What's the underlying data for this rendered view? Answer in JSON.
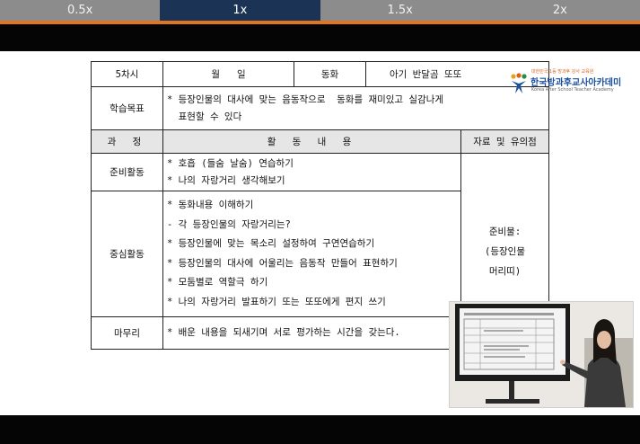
{
  "speed_controls": [
    {
      "label": "0.5x",
      "active": false
    },
    {
      "label": "1x",
      "active": true
    },
    {
      "label": "1.5x",
      "active": false
    },
    {
      "label": "2x",
      "active": false
    }
  ],
  "colors": {
    "speed_bar": "#8c8c8c",
    "speed_active": "#1b3354",
    "accent_line": "#e3741f",
    "logo_blue": "#1a4f9c",
    "logo_orange": "#d9621b"
  },
  "logo": {
    "tagline": "대한민국 1등 방과후 강사 교육원",
    "name": "한국방과후교사아카데미",
    "sub": "Korea After School Teacher Academy"
  },
  "lesson_table": {
    "row1": {
      "session": "5차시",
      "month_day": "월   일",
      "genre_label": "동화",
      "title": "아기 반달곰 또또"
    },
    "objective": {
      "label": "학습목표",
      "lines": [
        "* 등장인물의 대사에 맞는 음동작으로  동화를 재미있고 실감나게",
        "  표현할 수 있다"
      ]
    },
    "header": {
      "process": "과    정",
      "activity": "활 동 내 용",
      "materials": "자료 및 유의점"
    },
    "prep": {
      "label": "준비활동",
      "lines": [
        "* 호흡 (들숨 날숨) 연습하기",
        "* 나의 자랑거리 생각해보기"
      ]
    },
    "main": {
      "label": "중심활동",
      "lines": [
        "* 동화내용 이해하기",
        "- 각 등장인물의 자랑거리는?",
        "* 등장인물에 맞는 목소리 설정하여 구연연습하기",
        "* 등장인물의 대사에 어울리는 음동작 만들어 표현하기",
        "* 모둠별로 역할극 하기",
        "* 나의 자랑거리 발표하기 또는 또또에게 편지 쓰기"
      ]
    },
    "materials": [
      "준비물:",
      "(등장인물",
      "머리띠)"
    ],
    "closing": {
      "label": "마무리",
      "lines": [
        "* 배운 내용을 되새기며 서로 평가하는 시간을 갖는다."
      ]
    }
  }
}
